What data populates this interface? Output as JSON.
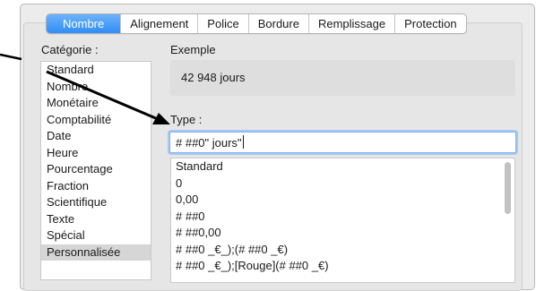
{
  "tabs": [
    "Nombre",
    "Alignement",
    "Police",
    "Bordure",
    "Remplissage",
    "Protection"
  ],
  "active_tab": "Nombre",
  "category": {
    "label": "Catégorie :",
    "items": [
      "Standard",
      "Nombre",
      "Monétaire",
      "Comptabilité",
      "Date",
      "Heure",
      "Pourcentage",
      "Fraction",
      "Scientifique",
      "Texte",
      "Spécial",
      "Personnalisée"
    ],
    "selected": "Personnalisée"
  },
  "example": {
    "label": "Exemple",
    "value": "42 948 jours"
  },
  "type": {
    "label": "Type :",
    "value": "# ##0\" jours\"",
    "formats": [
      "Standard",
      "0",
      "0,00",
      "# ##0",
      "# ##0,00",
      "# ##0 _€_);(# ##0 _€)",
      "# ##0 _€_);[Rouge](# ##0 _€)"
    ]
  },
  "colors": {
    "accent": "#2f8df5",
    "focus_ring": "#a7c9f4",
    "annotation_arrow": "#000000"
  }
}
